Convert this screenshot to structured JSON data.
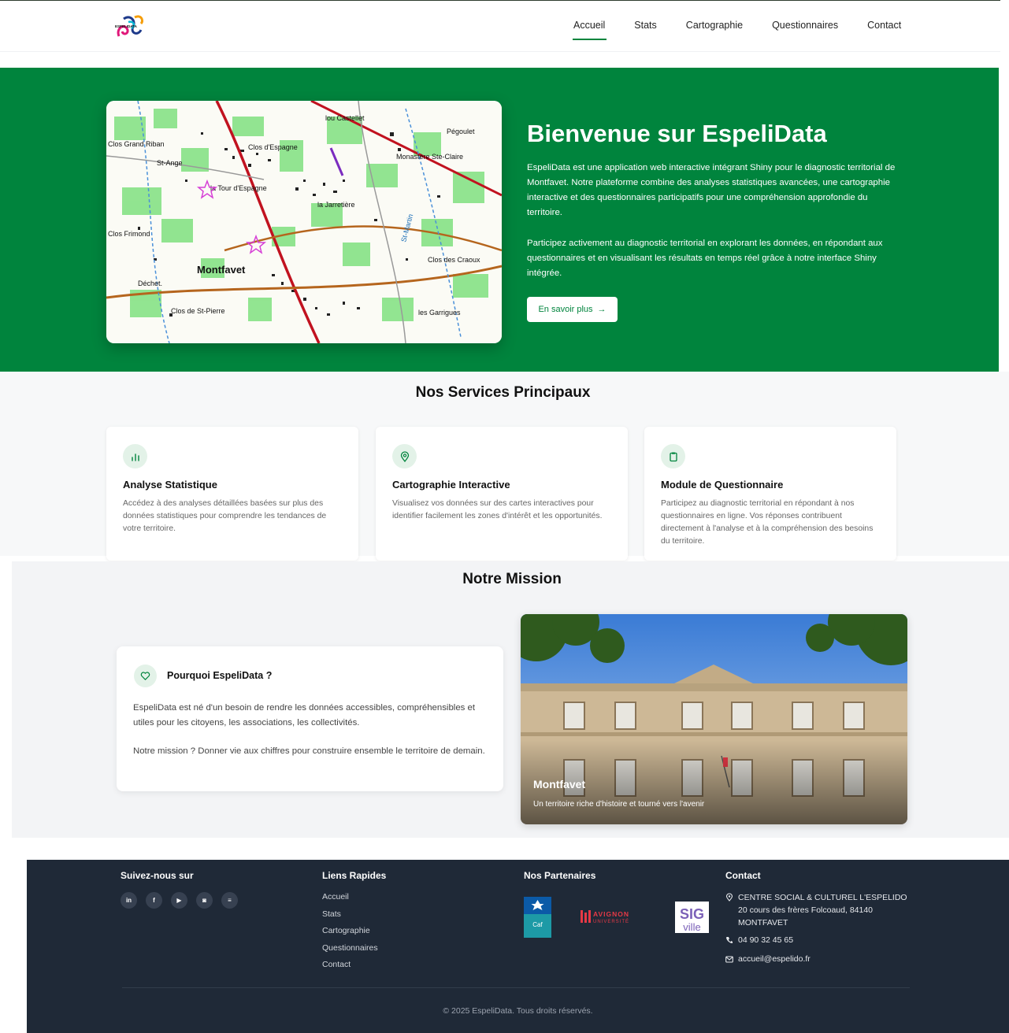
{
  "brand": {
    "logo_text": "ESPELIDATA"
  },
  "nav": {
    "items": [
      "Accueil",
      "Stats",
      "Cartographie",
      "Questionnaires",
      "Contact"
    ],
    "active": "Accueil"
  },
  "hero": {
    "title": "Bienvenue sur EspeliData",
    "paragraph1": "EspeliData est une application web interactive intégrant Shiny pour le diagnostic territorial de Montfavet. Notre plateforme combine des analyses statistiques avancées, une cartographie interactive et des questionnaires participatifs pour une compréhension approfondie du territoire.",
    "paragraph2": "Participez activement au diagnostic territorial en explorant les données, en répondant aux questionnaires et en visualisant les résultats en temps réel grâce à notre interface Shiny intégrée.",
    "button": "En savoir plus",
    "button_icon": "arrow-right-icon",
    "map_labels": [
      "lou Castellet",
      "Pégoulet",
      "Clos Grand Riban",
      "St-Ange",
      "Clos d'Espagne",
      "Monastère Ste-Claire",
      "la Tour d'Espagne",
      "Clos Frimond",
      "Montfavet",
      "Clos des Craoux",
      "Clos de St-Pierre",
      "les Garrigues",
      "la Jarretière",
      "St-Martin",
      "Déchet."
    ]
  },
  "services": {
    "title": "Nos Services Principaux",
    "cards": [
      {
        "icon": "bar-chart-icon",
        "title": "Analyse Statistique",
        "desc": "Accédez à des analyses détaillées basées sur plus des données statistiques pour comprendre les tendances de votre territoire."
      },
      {
        "icon": "map-pin-icon",
        "title": "Cartographie Interactive",
        "desc": "Visualisez vos données sur des cartes interactives pour identifier facilement les zones d'intérêt et les opportunités."
      },
      {
        "icon": "clipboard-icon",
        "title": "Module de Questionnaire",
        "desc": "Participez au diagnostic territorial en répondant à nos questionnaires en ligne. Vos réponses contribuent directement à l'analyse et à la compréhension des besoins du territoire."
      }
    ]
  },
  "mission": {
    "title": "Notre Mission",
    "card_title": "Pourquoi EspeliData ?",
    "card_icon": "heart-icon",
    "p1": "EspeliData est né d'un besoin de rendre les données accessibles, compréhensibles et utiles pour les citoyens, les associations, les collectivités.",
    "p2": "Notre mission ? Donner vie aux chiffres pour construire ensemble le territoire de demain.",
    "photo_title": "Montfavet",
    "photo_caption": "Un territoire riche d'histoire et tourné vers l'avenir"
  },
  "footer": {
    "social_title": "Suivez-nous sur",
    "social": [
      {
        "icon": "linkedin-icon",
        "glyph": "in"
      },
      {
        "icon": "facebook-icon",
        "glyph": "f"
      },
      {
        "icon": "youtube-icon",
        "glyph": "▶"
      },
      {
        "icon": "instagram-icon",
        "glyph": "◙"
      },
      {
        "icon": "spotify-icon",
        "glyph": "≡"
      }
    ],
    "links_title": "Liens Rapides",
    "links": [
      "Accueil",
      "Stats",
      "Cartographie",
      "Questionnaires",
      "Contact"
    ],
    "partners_title": "Nos Partenaires",
    "partners": {
      "caf_text": "Caf",
      "avignon_top": "AVIGNON",
      "avignon_bottom": "UNIVERSITÉ",
      "sig_top": "SIG",
      "sig_bottom": "ville"
    },
    "contact_title": "Contact",
    "address": "CENTRE SOCIAL & CULTUREL L'ESPELIDO 20 cours des frères Folcoaud, 84140 MONTFAVET",
    "phone": "04 90 32 45 65",
    "email": "accueil@espelido.fr",
    "copyright": "© 2025 EspeliData. Tous droits réservés."
  },
  "colors": {
    "primary": "#00843d",
    "footer_bg": "#1f2937",
    "section_bg": "#f7f8f9"
  }
}
